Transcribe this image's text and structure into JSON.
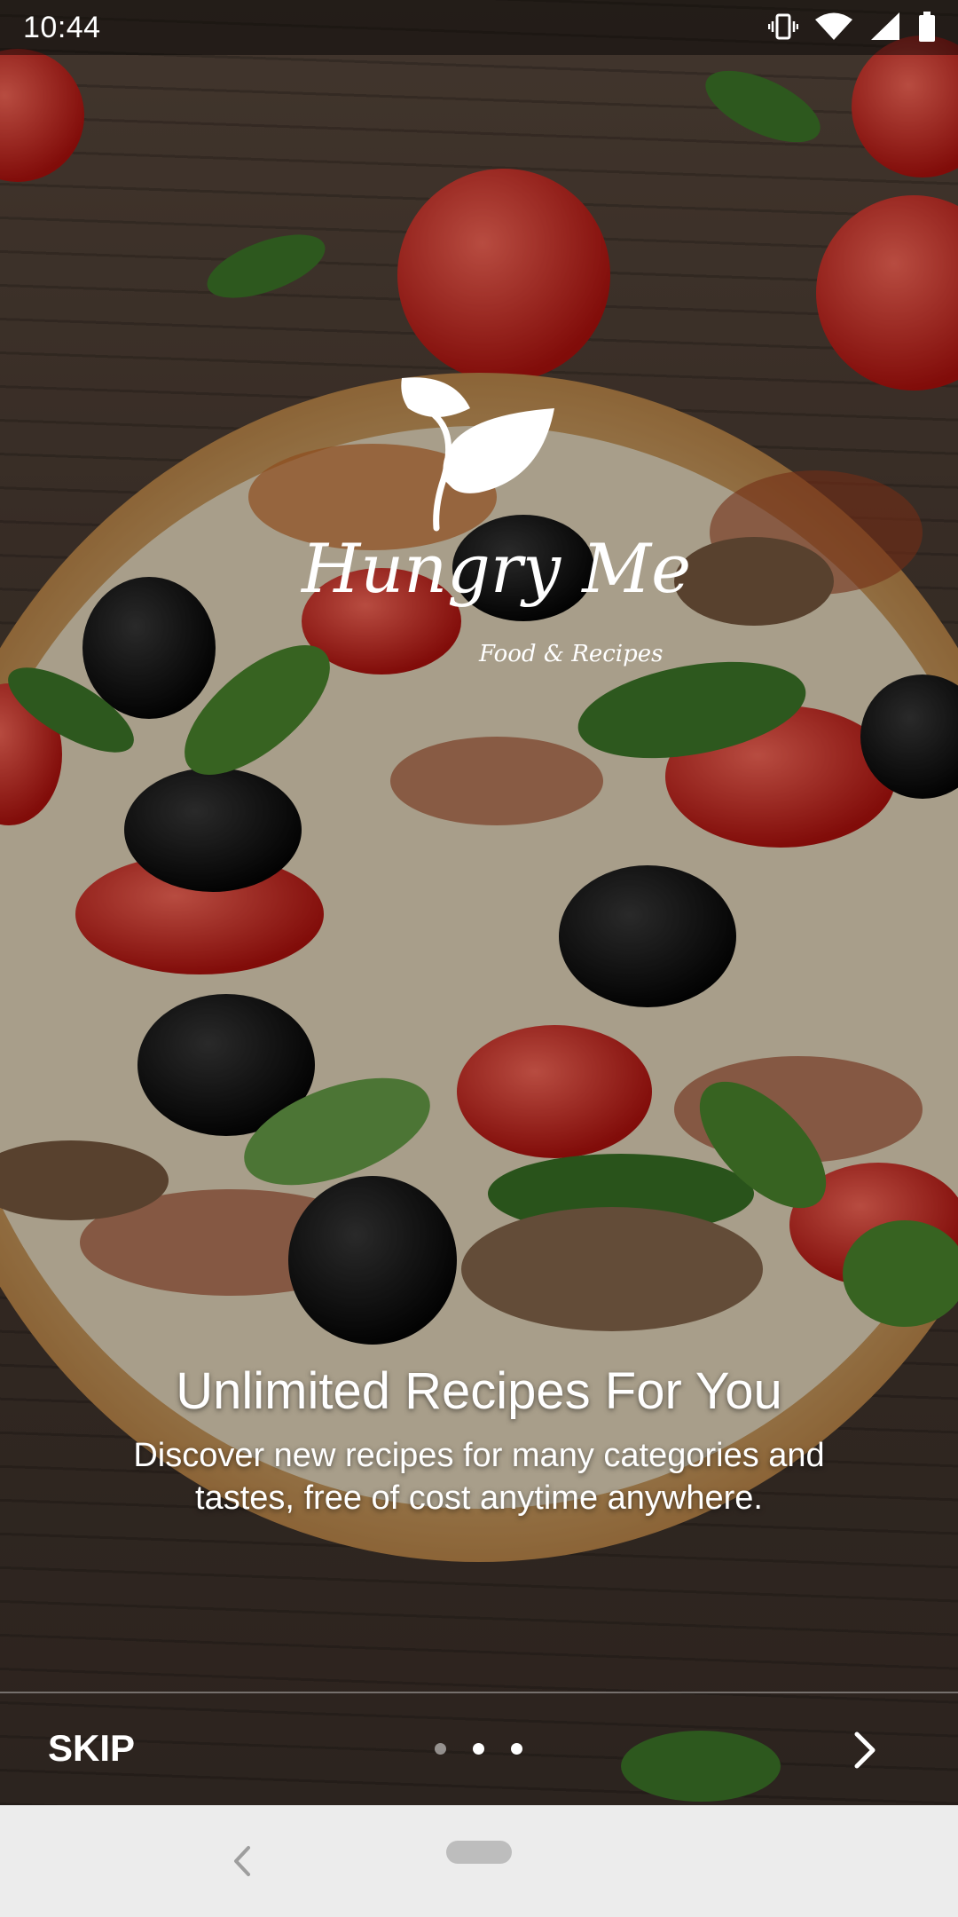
{
  "status_bar": {
    "time": "10:44",
    "icons": [
      "vibrate-icon",
      "wifi-icon",
      "signal-icon",
      "battery-icon"
    ]
  },
  "logo": {
    "title": "Hungry Me",
    "subtitle": "Food & Recipes",
    "icon": "leaf-icon"
  },
  "onboarding": {
    "headline": "Unlimited Recipes For You",
    "description": "Discover new recipes for many categories and tastes, free of cost anytime anywhere.",
    "total_pages": 3,
    "current_page": 2
  },
  "controls": {
    "skip_label": "SKIP",
    "next_icon": "chevron-right-icon"
  },
  "nav_bar": {
    "back_icon": "back-icon",
    "home_icon": "home-pill-icon"
  },
  "colors": {
    "text": "#ffffff",
    "nav_background": "#ececec"
  }
}
